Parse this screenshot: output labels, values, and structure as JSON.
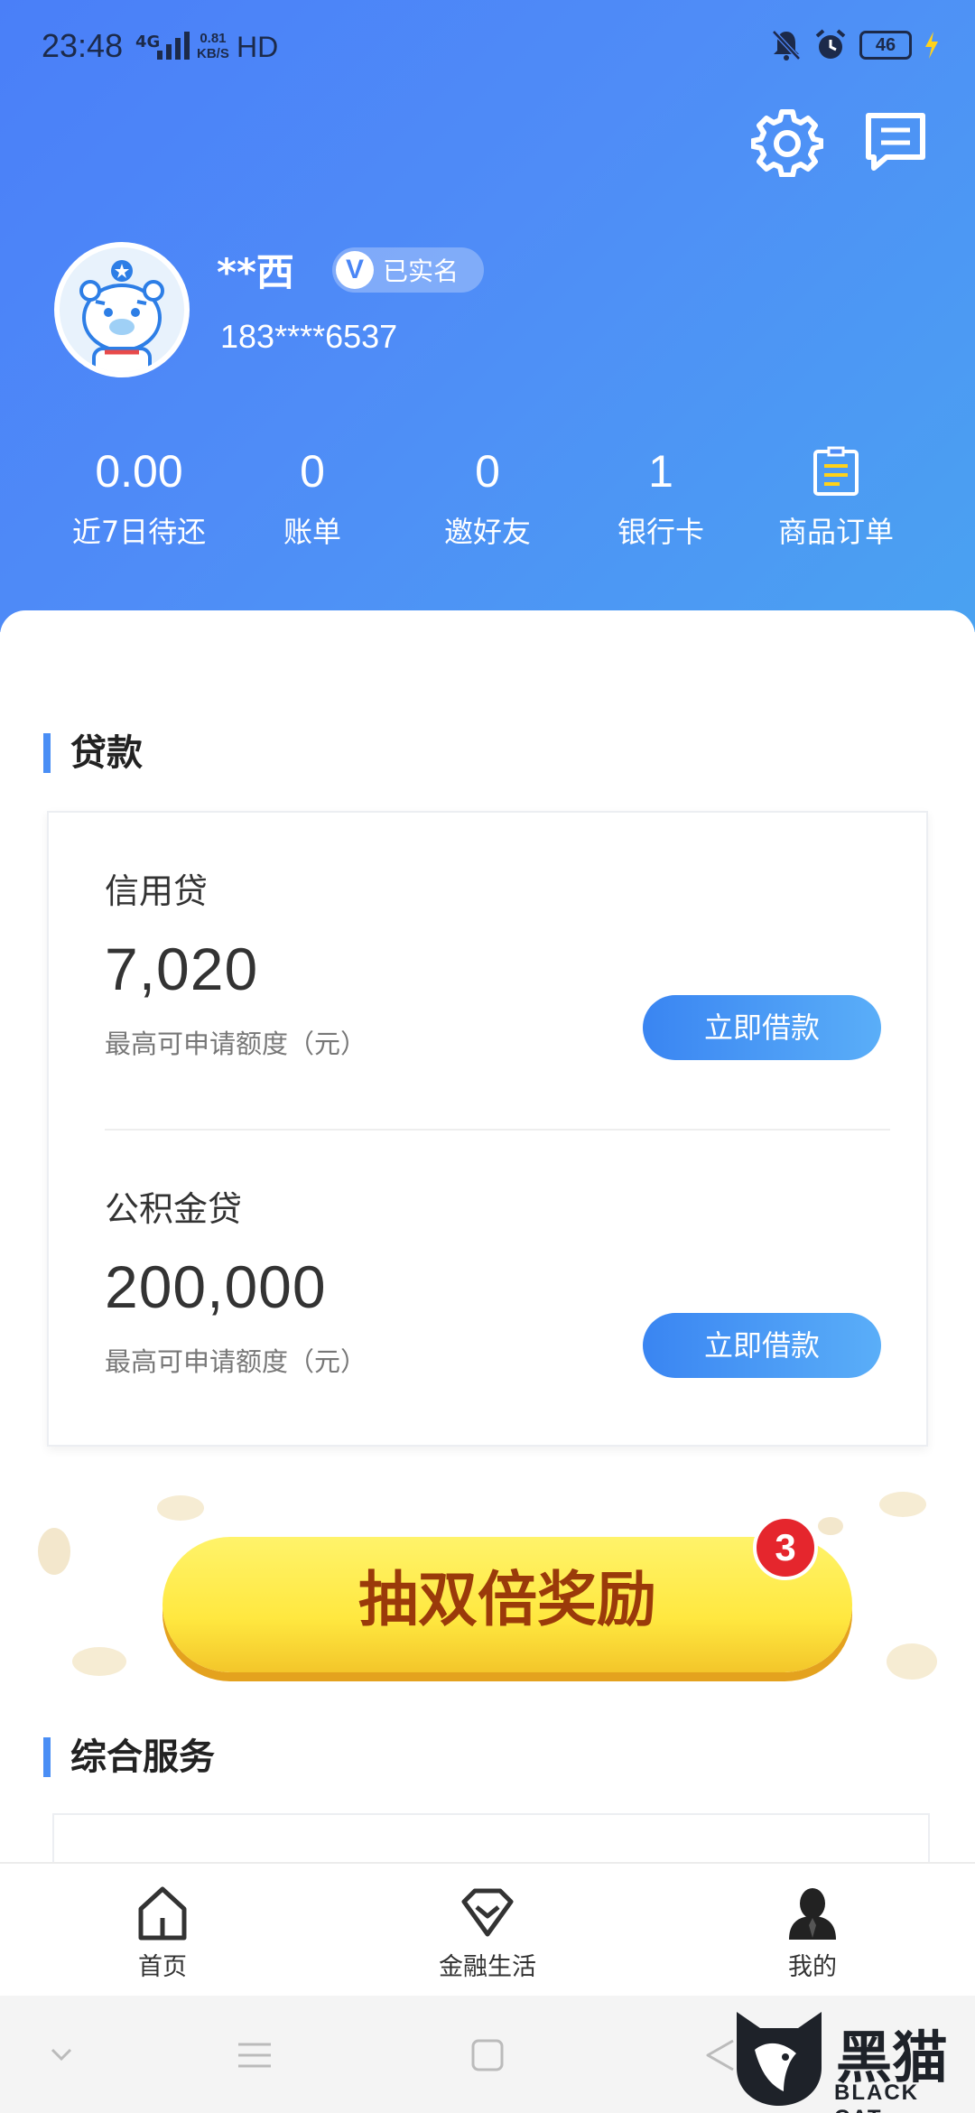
{
  "status_bar": {
    "time": "23:48",
    "network": "4G",
    "speed_value": "0.81",
    "speed_unit": "KB/S",
    "hd": "HD",
    "battery": "46"
  },
  "header": {
    "icons": [
      "gear-icon",
      "message-icon"
    ]
  },
  "profile": {
    "name": "**西",
    "verified_badge": "V",
    "verified_label": "已实名",
    "phone": "183****6537"
  },
  "stats": [
    {
      "value": "0.00",
      "label": "近7日待还"
    },
    {
      "value": "0",
      "label": "账单"
    },
    {
      "value": "0",
      "label": "邀好友"
    },
    {
      "value": "1",
      "label": "银行卡"
    },
    {
      "value": "",
      "label": "商品订单"
    }
  ],
  "loans": {
    "section_title": "贷款",
    "items": [
      {
        "name": "信用贷",
        "amount": "7,020",
        "desc": "最高可申请额度（元）",
        "button": "立即借款"
      },
      {
        "name": "公积金贷",
        "amount": "200,000",
        "desc": "最高可申请额度（元）",
        "button": "立即借款"
      }
    ]
  },
  "promo": {
    "label": "抽双倍奖励",
    "badge": "3"
  },
  "services": {
    "section_title": "综合服务"
  },
  "tabbar": [
    {
      "label": "首页",
      "icon": "home-icon"
    },
    {
      "label": "金融生活",
      "icon": "diamond-icon"
    },
    {
      "label": "我的",
      "icon": "person-icon"
    }
  ],
  "watermark": {
    "cn": "黑猫",
    "en": "BLACK CAT"
  },
  "colors": {
    "header_start": "#4a7ff8",
    "header_end": "#4aa2f1",
    "accent": "#4a8ef5",
    "promo_text": "#9a3a0a",
    "badge": "#e5262d"
  }
}
